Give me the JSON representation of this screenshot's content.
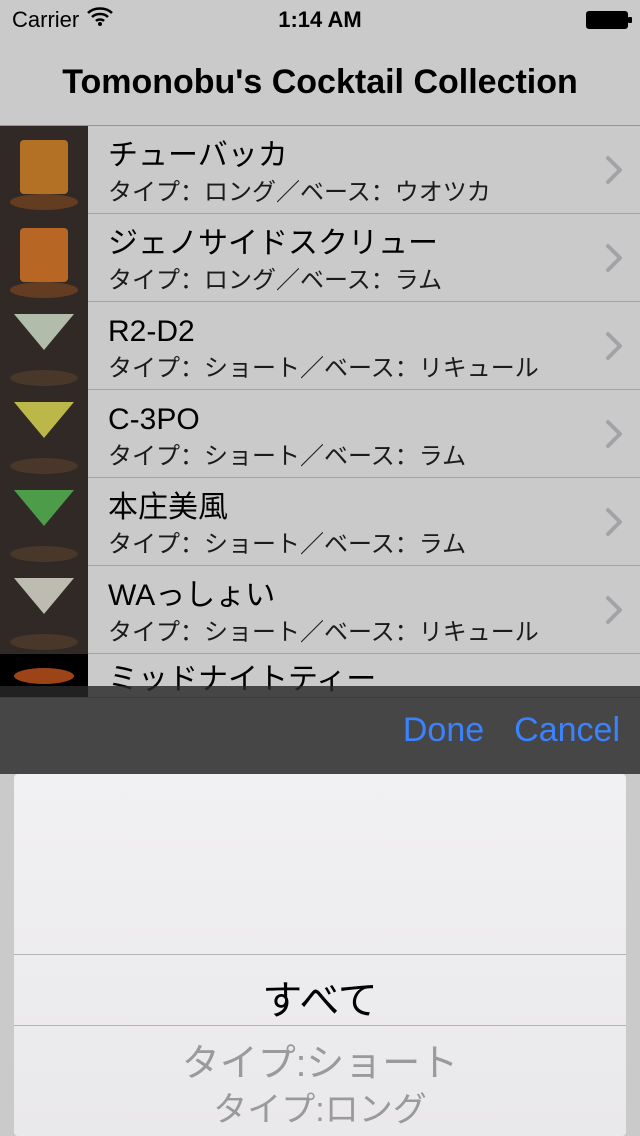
{
  "status": {
    "carrier": "Carrier",
    "time": "1:14 AM"
  },
  "nav": {
    "title": "Tomonobu's Cocktail Collection"
  },
  "rows": [
    {
      "title": "チューバッカ",
      "subtitle": "タイプ：ロング／ベース：ウオツカ"
    },
    {
      "title": "ジェノサイドスクリュー",
      "subtitle": "タイプ：ロング／ベース：ラム"
    },
    {
      "title": "R2-D2",
      "subtitle": "タイプ：ショート／ベース：リキュール"
    },
    {
      "title": "C-3PO",
      "subtitle": "タイプ：ショート／ベース：ラム"
    },
    {
      "title": "本庄美風",
      "subtitle": "タイプ：ショート／ベース：ラム"
    },
    {
      "title": "WAっしょい",
      "subtitle": "タイプ：ショート／ベース：リキュール"
    },
    {
      "title": "ミッドナイトティー",
      "subtitle": ""
    }
  ],
  "thumbs": [
    {
      "kind": "tumbler",
      "fill": "#d98a2e",
      "coaster": "#7a4a2a"
    },
    {
      "kind": "tumbler",
      "fill": "#e07d2c",
      "coaster": "#7a4a2a"
    },
    {
      "kind": "martini",
      "fill": "#d9e6d0",
      "coaster": "#5a4433"
    },
    {
      "kind": "martini",
      "fill": "#e6e05a",
      "coaster": "#5a4433"
    },
    {
      "kind": "martini",
      "fill": "#5fbf5a",
      "coaster": "#5a4433"
    },
    {
      "kind": "martini",
      "fill": "#e6e6d8",
      "coaster": "#5a4433"
    },
    {
      "kind": "bowl",
      "fill": "#c0521e",
      "bg": "#000"
    }
  ],
  "picker_toolbar": {
    "done": "Done",
    "cancel": "Cancel"
  },
  "picker_options": {
    "selected": "すべて",
    "below1": "タイプ:ショート",
    "below2": "タイプ:ロング"
  }
}
